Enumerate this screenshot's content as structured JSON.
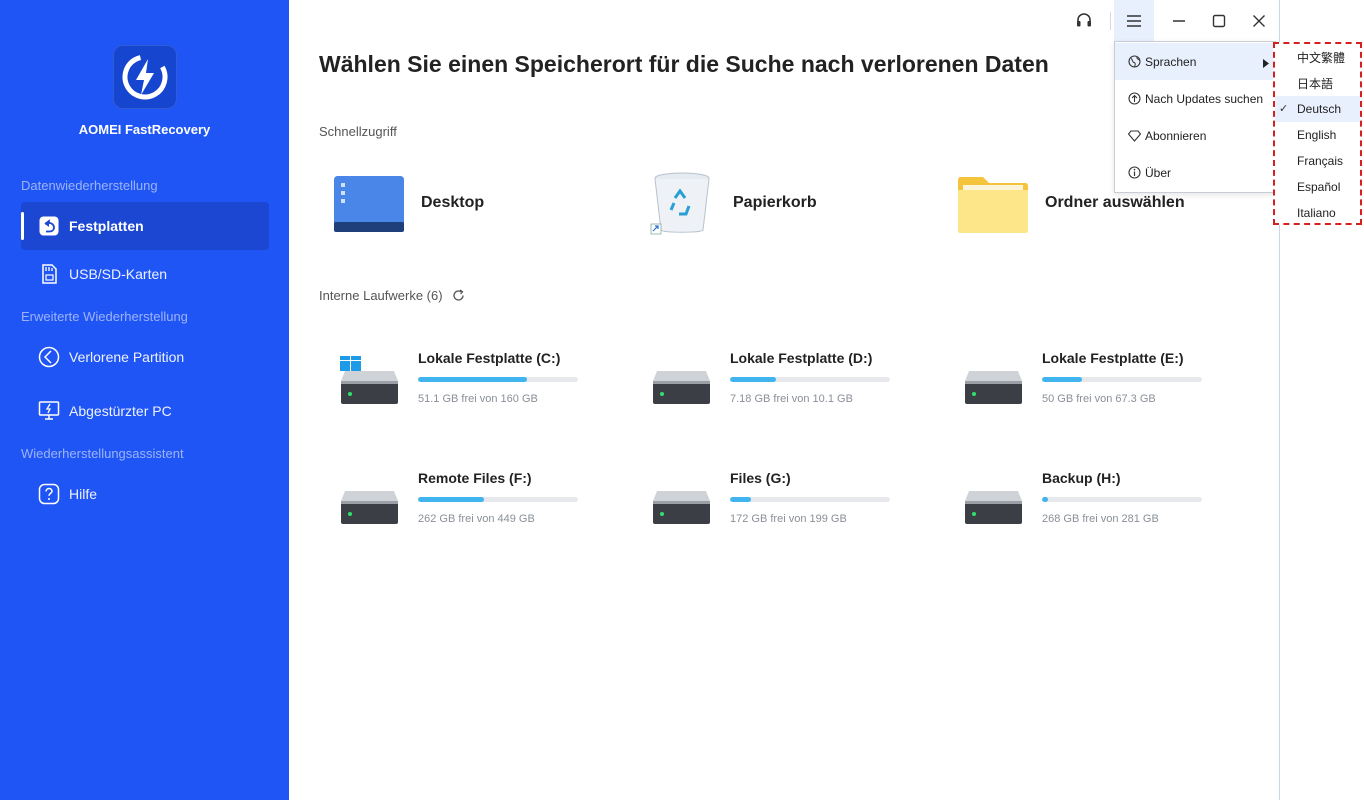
{
  "app": {
    "brand": "AOMEI FastRecovery"
  },
  "sidebar": {
    "sections": [
      "Datenwiederherstellung",
      "Erweiterte Wiederherstellung",
      "Wiederherstellungsassistent"
    ],
    "items": [
      {
        "label": "Festplatten",
        "icon": "drive-restore-icon",
        "active": true
      },
      {
        "label": "USB/SD-Karten",
        "icon": "sd-card-icon"
      },
      {
        "label": "Verlorene Partition",
        "icon": "partition-icon"
      },
      {
        "label": "Abgestürzter PC",
        "icon": "crashed-pc-icon"
      },
      {
        "label": "Hilfe",
        "icon": "help-icon"
      }
    ]
  },
  "main": {
    "title": "Wählen Sie einen Speicherort für die Suche nach verlorenen Daten",
    "quick_access": {
      "label": "Schnellzugriff",
      "items": [
        {
          "label": "Desktop",
          "icon": "desktop-icon"
        },
        {
          "label": "Papierkorb",
          "icon": "recycle-bin-icon"
        },
        {
          "label": "Ordner auswählen",
          "icon": "folder-icon"
        }
      ]
    },
    "drives_label": "Interne Laufwerke (6)",
    "drives": [
      {
        "name": "Lokale Festplatte (C:)",
        "size": "51.1 GB frei von 160 GB",
        "used_fraction": 0.68,
        "system": true
      },
      {
        "name": "Lokale Festplatte (D:)",
        "size": "7.18 GB frei von 10.1 GB",
        "used_fraction": 0.29
      },
      {
        "name": "Lokale Festplatte (E:)",
        "size": "50 GB frei von 67.3 GB",
        "used_fraction": 0.25
      },
      {
        "name": "Remote Files (F:)",
        "size": "262 GB frei von 449 GB",
        "used_fraction": 0.41
      },
      {
        "name": "Files (G:)",
        "size": "172 GB frei von 199 GB",
        "used_fraction": 0.13
      },
      {
        "name": "Backup (H:)",
        "size": "268 GB frei von 281 GB",
        "used_fraction": 0.04
      }
    ]
  },
  "menu": {
    "items": [
      {
        "label": "Sprachen",
        "icon": "globe-icon",
        "has_submenu": true
      },
      {
        "label": "Nach Updates suchen",
        "icon": "update-icon"
      },
      {
        "label": "Abonnieren",
        "icon": "diamond-icon"
      },
      {
        "label": "Über",
        "icon": "info-icon"
      }
    ]
  },
  "languages": {
    "items": [
      "中文繁體",
      "日本語",
      "Deutsch",
      "English",
      "Français",
      "Español",
      "Italiano"
    ],
    "selected": "Deutsch"
  },
  "colors": {
    "sidebar": "#2055f5",
    "accent": "#3fb4ee",
    "highlight": "#d62020"
  }
}
